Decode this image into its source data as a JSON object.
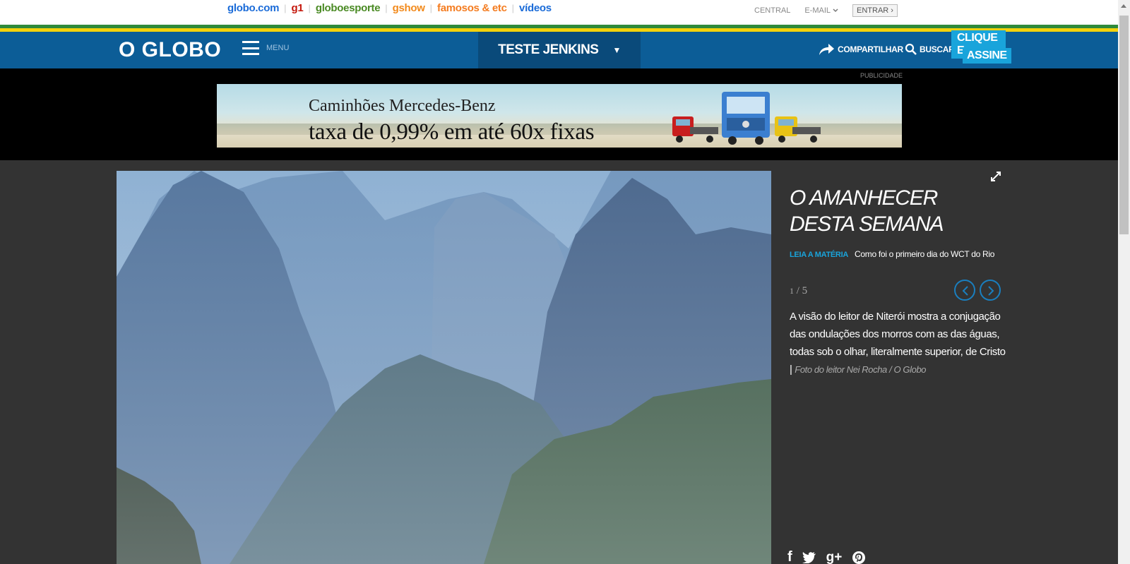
{
  "globo_bar": {
    "links": [
      {
        "label": "globo.com",
        "color": "#1a6bd8"
      },
      {
        "label": "g1",
        "color": "#c4170c"
      },
      {
        "label": "globoesporte",
        "color": "#4a8a24"
      },
      {
        "label": "gshow",
        "color": "#f28a1c"
      },
      {
        "label": "famosos & etc",
        "color": "#f47c20"
      },
      {
        "label": "vídeos",
        "color": "#1a6bd8"
      }
    ],
    "central": "CENTRAL",
    "email": "E-MAIL",
    "entrar": "ENTRAR ›"
  },
  "stripe_colors": [
    "#2f8a3b",
    "#f4d20c",
    "#1b67a5"
  ],
  "header": {
    "logo": "O GLOBO",
    "menu_label": "MENU",
    "section_label": "TESTE JENKINS",
    "section_caret": "▼",
    "share_label": "COMPARTILHAR",
    "search_label": "BUSCAR",
    "assine_line1": "CLIQUE E",
    "assine_line2": "ASSINE"
  },
  "ad": {
    "label": "PUBLICIDADE",
    "line1": "Caminhões Mercedes-Benz",
    "line2": "taxa de 0,99% em até 60x fixas"
  },
  "gallery": {
    "title": "O AMANHECER DESTA SEMANA",
    "leia_label": "LEIA A MATÉRIA",
    "leia_link": "Como foi o primeiro dia do WCT do Rio",
    "current": "1",
    "separator": "/",
    "total": "5",
    "caption": "A visão do leitor de Niterói mostra a conjugação das ondulações dos morros com as das águas, todas sob o olhar, literalmente superior, de Cristo |",
    "credit": "Foto do leitor Nei Rocha / O Globo"
  },
  "icons": {
    "expand": "expand-icon",
    "prev": "chevron-left-icon",
    "next": "chevron-right-icon",
    "share": "share-arrow-icon",
    "search": "search-icon",
    "facebook": "facebook-icon",
    "twitter": "twitter-icon",
    "googleplus": "google-plus-icon",
    "pinterest": "pinterest-icon"
  }
}
